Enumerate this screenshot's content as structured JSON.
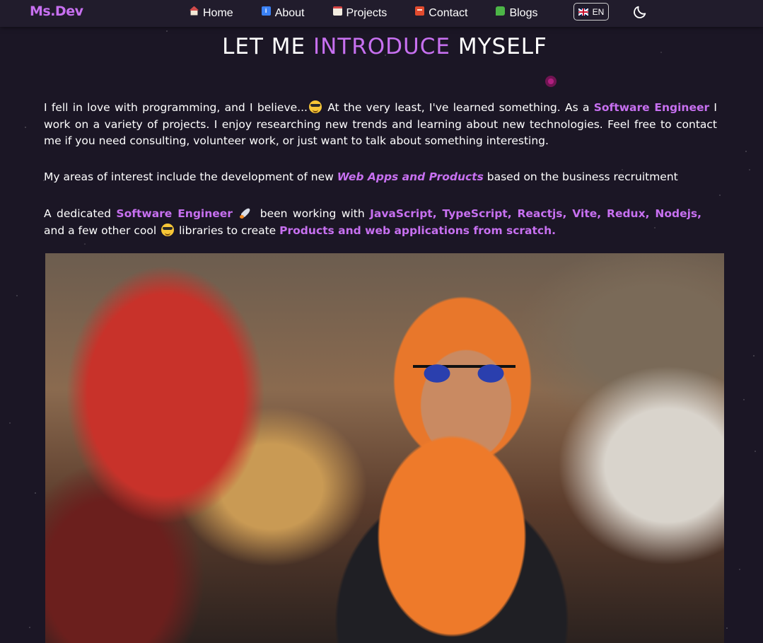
{
  "brand": "Ms.Dev",
  "nav": {
    "items": [
      {
        "label": "Home",
        "icon": "house-icon"
      },
      {
        "label": "About",
        "icon": "info-icon"
      },
      {
        "label": "Projects",
        "icon": "document-icon"
      },
      {
        "label": "Contact",
        "icon": "contact-card-icon"
      },
      {
        "label": "Blogs",
        "icon": "speech-bubble-icon"
      }
    ],
    "language": "EN",
    "theme_icon": "moon-icon"
  },
  "heading": {
    "part1": "LET ME",
    "accent": "INTRODUCE",
    "part2": "MYSELF"
  },
  "para1": {
    "t1": "I fell in love with programming, and I believe...",
    "t2": " At the very least, I've learned something. As a ",
    "hl1": "Software Engineer",
    "t3": " I work on a variety of projects. I enjoy researching new trends and learning about new technologies. Feel free to contact me if you need consulting, volunteer work, or just want to talk about something interesting."
  },
  "para2": {
    "t1": "My areas of interest include the development of new ",
    "hl1": "Web Apps and Products",
    "t2": " based on the business recruitment"
  },
  "para3": {
    "t1": "A dedicated ",
    "hl1": "Software Engineer",
    "t2": " been working with ",
    "hl2": "JavaScript, TypeScript, Reactjs, Vite, Redux, Nodejs,",
    "t3": " and a few other cool ",
    "t4": " libraries to create ",
    "hl3": "Products and web applications from scratch."
  },
  "colors": {
    "accent": "#c770f0",
    "background": "#1b1625",
    "navbar": "#211c2c"
  }
}
